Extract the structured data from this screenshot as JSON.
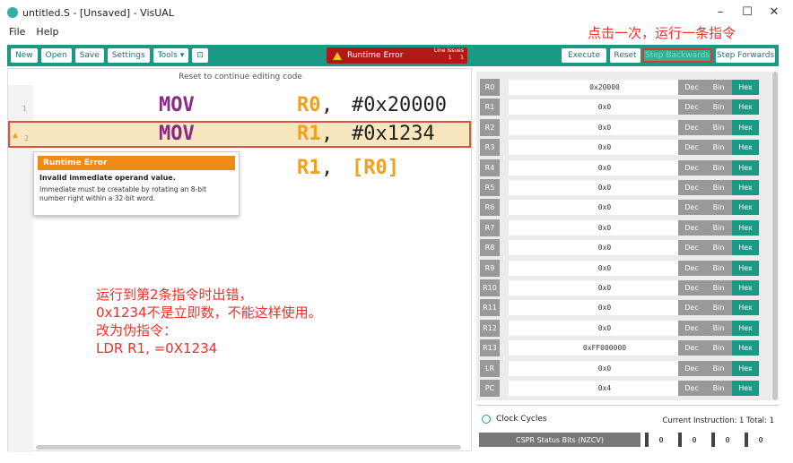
{
  "window": {
    "title": "untitled.S - [Unsaved] - VisUAL"
  },
  "menu": [
    "File",
    "Help"
  ],
  "annotation_top": "点击一次，运行一条指令",
  "toolbar": {
    "new": "New",
    "open": "Open",
    "save": "Save",
    "settings": "Settings",
    "tools": "Tools ▾",
    "monitor": "⊡",
    "error_label": "Runtime Error",
    "line_label": "Line",
    "issues_label": "Issues",
    "line_value": "1",
    "issues_value": "1",
    "execute": "Execute",
    "reset": "Reset",
    "step_backwards": "Step Backwards",
    "step_forwards": "Step Forwards"
  },
  "editor": {
    "reset_hint": "Reset to continue editing code",
    "lines": [
      {
        "num": "1",
        "op": "MOV",
        "reg": "R0",
        "sep": ", ",
        "arg": "#0x20000"
      },
      {
        "num": "2",
        "op": "MOV",
        "reg": "R1",
        "sep": ", ",
        "arg": "#0x1234"
      },
      {
        "num": "",
        "op": "",
        "reg": "R1",
        "sep": ", ",
        "arg": "[R0]"
      }
    ]
  },
  "tooltip": {
    "title": "Runtime Error",
    "heading": "Invalid immediate operand value.",
    "detail": "Immediate must be creatable by rotating an 8-bit number right within a 32-bit word."
  },
  "annotation": [
    "运行到第2条指令时出错，",
    "0x1234不是立即数，不能这样使用。",
    "改为伪指令：",
    "LDR  R1, =0X1234"
  ],
  "registers": [
    {
      "name": "R0",
      "value": "0x20000"
    },
    {
      "name": "R1",
      "value": "0x0"
    },
    {
      "name": "R2",
      "value": "0x0"
    },
    {
      "name": "R3",
      "value": "0x0"
    },
    {
      "name": "R4",
      "value": "0x0"
    },
    {
      "name": "R5",
      "value": "0x0"
    },
    {
      "name": "R6",
      "value": "0x0"
    },
    {
      "name": "R7",
      "value": "0x0"
    },
    {
      "name": "R8",
      "value": "0x0"
    },
    {
      "name": "R9",
      "value": "0x0"
    },
    {
      "name": "R10",
      "value": "0x0"
    },
    {
      "name": "R11",
      "value": "0x0"
    },
    {
      "name": "R12",
      "value": "0x0"
    },
    {
      "name": "R13",
      "value": "0xFF000000"
    },
    {
      "name": "LR",
      "value": "0x0"
    },
    {
      "name": "PC",
      "value": "0x4"
    }
  ],
  "register_buttons": {
    "dec": "Dec",
    "bin": "Bin",
    "hex": "Hex"
  },
  "bottom": {
    "clock_label": "Clock Cycles",
    "current_instruction": "Current Instruction:  1  Total:  1",
    "cspr_label": "CSPR Status Bits (NZCV)",
    "flags": [
      "0",
      "0",
      "0",
      "0"
    ]
  },
  "colors": {
    "accent": "#1a9a85",
    "error": "#b31818",
    "warning": "#ef8a16",
    "annotation": "#e8322c"
  }
}
